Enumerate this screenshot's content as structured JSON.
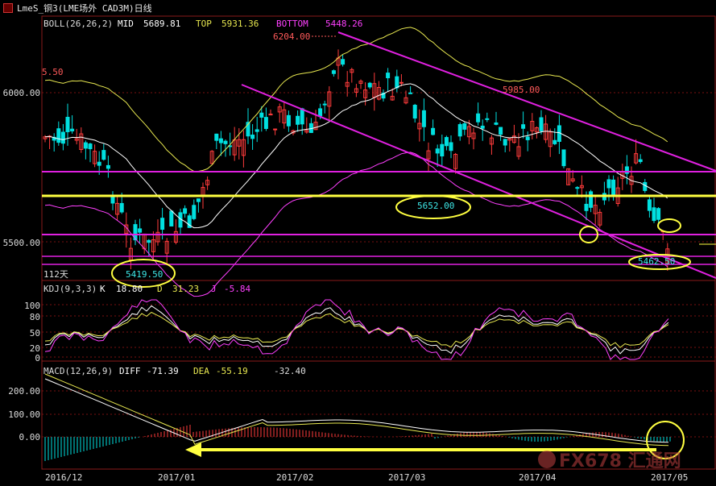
{
  "window": {
    "title": "LmeS_铜3(LME场外 CAD3M)日线"
  },
  "colors": {
    "up": "#ff3b3b",
    "down": "#00e0e0",
    "mid": "#ffffff",
    "top": "#e8e850",
    "bottom": "#ff40ff",
    "channel": "#e020e0",
    "support": "#ffff40",
    "grid": "#7a1010"
  },
  "boll": {
    "label": "BOLL(26,26,2)",
    "mid_label": "MID",
    "mid_value": "5689.81",
    "top_label": "TOP",
    "top_value": "5931.36",
    "bottom_label": "BOTTOM",
    "bottom_value": "5448.26"
  },
  "annotations": {
    "high_6204": "6204.00",
    "left_edge": "5.50",
    "level_5985": "5985.00",
    "level_5652": "5652.00",
    "level_5419": "5419.50",
    "level_5462": "5462.50",
    "days_112": "112天"
  },
  "price_axis": {
    "ticks": [
      "6000.00",
      "5500.00"
    ]
  },
  "kdj": {
    "label": "KDJ(9,3,3)",
    "k_label": "K",
    "k_value": "18.80",
    "d_label": "D",
    "d_value": "31.23",
    "j_label": "J",
    "j_value": "-5.84",
    "ticks": [
      "100",
      "80",
      "50",
      "20",
      "0"
    ]
  },
  "macd": {
    "label": "MACD(12,26,9)",
    "diff_label": "DIFF",
    "diff_value": "-71.39",
    "dea_label": "DEA",
    "dea_value": "-55.19",
    "macd_value": "-32.40",
    "ticks": [
      "200.00",
      "100.00",
      "0.00"
    ]
  },
  "time_axis": {
    "labels": [
      "2016/12",
      "2017/01",
      "2017/02",
      "2017/03",
      "2017/04",
      "2017/05"
    ]
  },
  "watermark": {
    "text": "FX678 汇通网"
  }
}
